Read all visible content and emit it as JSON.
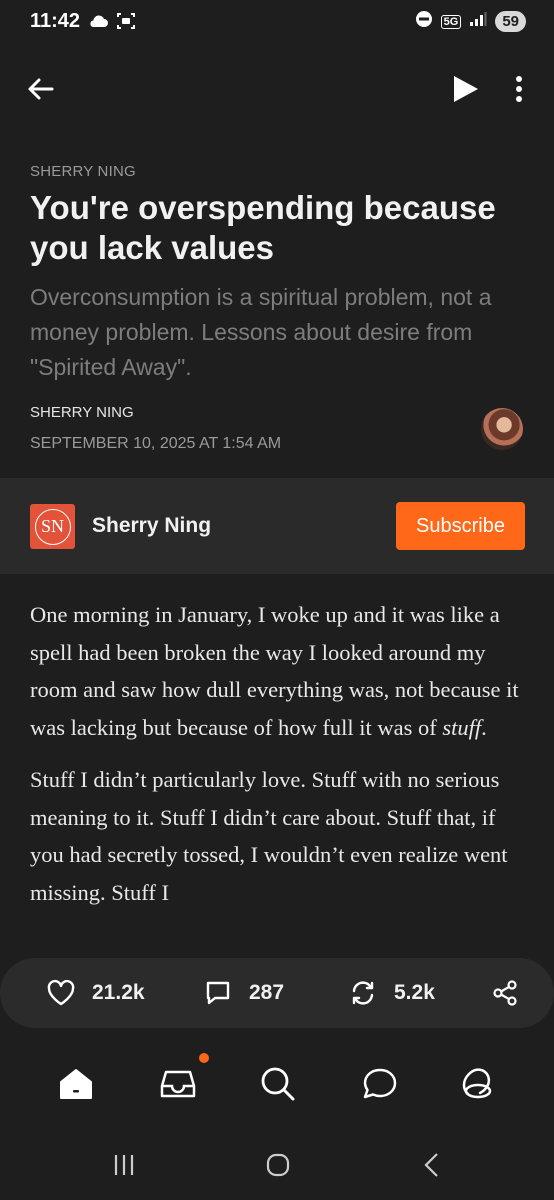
{
  "status": {
    "time": "11:42",
    "network": "5G",
    "battery": "59",
    "icons": [
      "cloud-icon",
      "screen-record-icon",
      "do-not-disturb-icon",
      "signal-icon"
    ]
  },
  "appbar": {
    "back_icon": "back-arrow-icon",
    "play_icon": "play-icon",
    "more_icon": "more-vertical-icon"
  },
  "article": {
    "publication": "SHERRY NING",
    "title": "You're overspending because you lack values",
    "subtitle": "Overconsumption is a spiritual problem, not a money problem. Lessons about desire from \"Spirited Away\".",
    "author": "SHERRY NING",
    "date": "SEPTEMBER 10, 2025 AT 1:54 AM"
  },
  "publication_band": {
    "logo_text": "SN",
    "name": "Sherry Ning",
    "subscribe_label": "Subscribe",
    "accent": "#ff6719"
  },
  "body": {
    "p1_text": "One morning in January, I woke up and it was like a spell had been broken the way I looked around my room and saw how dull everything was, not because it was lacking but because of how full it was of ",
    "p1_emph": "stuff",
    "p1_end": ".",
    "p2": "Stuff I didn’t particularly love. Stuff with no serious meaning to it. Stuff I didn’t care about. Stuff that, if you had secretly tossed, I wouldn’t even realize went missing. Stuff I"
  },
  "actions": {
    "likes": "21.2k",
    "comments": "287",
    "restacks": "5.2k"
  },
  "nav": {
    "items": [
      "home-icon",
      "inbox-icon",
      "search-icon",
      "chat-icon",
      "profile-icon"
    ],
    "inbox_badge_color": "#ff6719"
  }
}
